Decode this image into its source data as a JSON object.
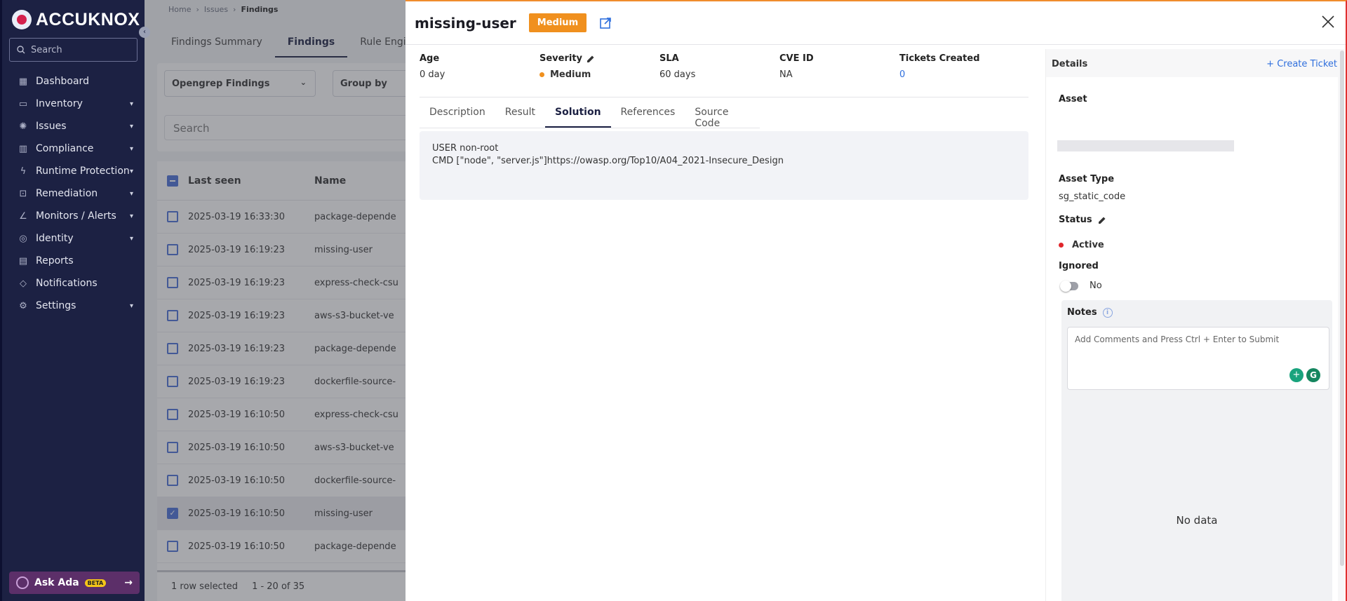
{
  "sidebar": {
    "logo_text": "ACCUKNOX",
    "search_placeholder": "Search",
    "items": [
      {
        "label": "Dashboard",
        "icon": "grid-icon",
        "chevron": false
      },
      {
        "label": "Inventory",
        "icon": "server-icon",
        "chevron": true
      },
      {
        "label": "Issues",
        "icon": "bug-icon",
        "chevron": true
      },
      {
        "label": "Compliance",
        "icon": "bar-chart-icon",
        "chevron": true
      },
      {
        "label": "Runtime Protection",
        "icon": "runtime-icon",
        "chevron": true
      },
      {
        "label": "Remediation",
        "icon": "remediation-icon",
        "chevron": true
      },
      {
        "label": "Monitors / Alerts",
        "icon": "line-chart-icon",
        "chevron": true
      },
      {
        "label": "Identity",
        "icon": "fingerprint-icon",
        "chevron": true
      },
      {
        "label": "Reports",
        "icon": "report-icon",
        "chevron": false
      },
      {
        "label": "Notifications",
        "icon": "bell-icon",
        "chevron": false
      },
      {
        "label": "Settings",
        "icon": "gear-icon",
        "chevron": true
      }
    ],
    "ask_ada": {
      "label": "Ask Ada",
      "badge": "BETA"
    }
  },
  "main": {
    "breadcrumb": [
      "Home",
      "Issues",
      "Findings"
    ],
    "tabs": [
      "Findings Summary",
      "Findings",
      "Rule Engine"
    ],
    "active_tab": "Findings",
    "filter_source": "Opengrep Findings",
    "group_by": "Group by",
    "search_placeholder": "Search",
    "table": {
      "columns": [
        "Last seen",
        "Name"
      ],
      "rows": [
        {
          "last_seen": "2025-03-19 16:33:30",
          "name": "package-depende",
          "checked": false
        },
        {
          "last_seen": "2025-03-19 16:19:23",
          "name": "missing-user",
          "checked": false
        },
        {
          "last_seen": "2025-03-19 16:19:23",
          "name": "express-check-csu",
          "checked": false
        },
        {
          "last_seen": "2025-03-19 16:19:23",
          "name": "aws-s3-bucket-ve",
          "checked": false
        },
        {
          "last_seen": "2025-03-19 16:19:23",
          "name": "package-depende",
          "checked": false
        },
        {
          "last_seen": "2025-03-19 16:19:23",
          "name": "dockerfile-source-",
          "checked": false
        },
        {
          "last_seen": "2025-03-19 16:10:50",
          "name": "express-check-csu",
          "checked": false
        },
        {
          "last_seen": "2025-03-19 16:10:50",
          "name": "aws-s3-bucket-ve",
          "checked": false
        },
        {
          "last_seen": "2025-03-19 16:10:50",
          "name": "dockerfile-source-",
          "checked": false
        },
        {
          "last_seen": "2025-03-19 16:10:50",
          "name": "missing-user",
          "checked": true
        },
        {
          "last_seen": "2025-03-19 16:10:50",
          "name": "package-depende",
          "checked": false
        }
      ]
    },
    "footer": {
      "selected": "1 row selected",
      "range": "1 - 20 of 35"
    }
  },
  "drawer": {
    "title": "missing-user",
    "severity_badge": "Medium",
    "meta": {
      "age_label": "Age",
      "age_value": "0 day",
      "severity_label": "Severity",
      "severity_value": "Medium",
      "sla_label": "SLA",
      "sla_value": "60 days",
      "cve_label": "CVE ID",
      "cve_value": "NA",
      "tickets_label": "Tickets Created",
      "tickets_value": "0"
    },
    "tabs": [
      "Description",
      "Result",
      "Solution",
      "References",
      "Source Code"
    ],
    "active_tab": "Solution",
    "solution_lines": [
      "USER non-root",
      "CMD [\"node\", \"server.js\"]https://owasp.org/Top10/A04_2021-Insecure_Design"
    ],
    "details": {
      "title": "Details",
      "create_ticket": "+ Create Ticket",
      "asset_label": "Asset",
      "asset_type_label": "Asset Type",
      "asset_type_value": "sg_static_code",
      "status_label": "Status",
      "status_value": "Active",
      "ignored_label": "Ignored",
      "ignored_value": "No",
      "notes_label": "Notes",
      "notes_placeholder": "Add Comments and Press Ctrl + Enter to Submit",
      "no_data": "No data"
    }
  },
  "colors": {
    "sidebar_bg": "#1c2143",
    "severity_medium": "#f0901e",
    "status_active": "#e0262b",
    "link": "#2f6fdd"
  }
}
